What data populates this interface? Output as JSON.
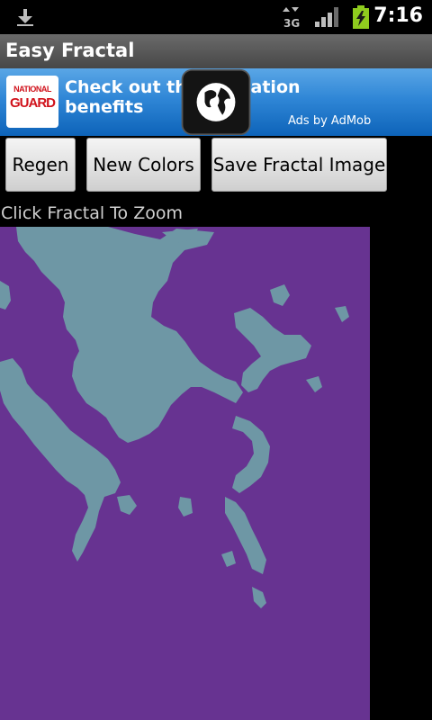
{
  "status_bar": {
    "time": "7:16",
    "network_label": "3G",
    "icons": [
      "download-icon",
      "network-3g-icon",
      "signal-icon",
      "battery-charging-icon"
    ]
  },
  "app": {
    "title": "Easy Fractal"
  },
  "ad": {
    "logo_top": "NATIONAL",
    "logo_bottom": "GUARD",
    "headline": "Check out the education benefits",
    "attribution": "Ads by AdMob",
    "action_icon": "globe-icon"
  },
  "toolbar": {
    "regen_label": "Regen",
    "new_colors_label": "New Colors",
    "save_label": "Save Fractal Image"
  },
  "hint": "Click Fractal To Zoom",
  "colors": {
    "fractal_background": "#673391",
    "fractal_foreground": "#6e97a5",
    "ad_background": "#1f77cd",
    "battery": "#8fcc1e"
  }
}
